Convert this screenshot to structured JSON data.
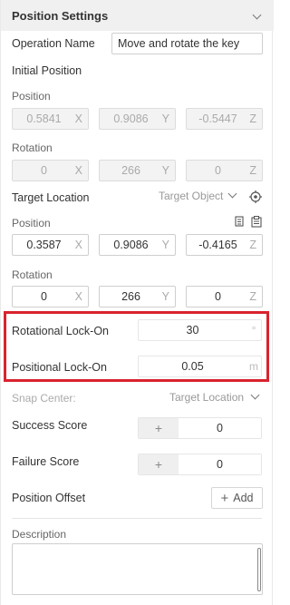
{
  "header": {
    "title": "Position Settings"
  },
  "operation": {
    "label": "Operation Name",
    "value": "Move and rotate the key"
  },
  "initial": {
    "heading": "Initial Position",
    "position_label": "Position",
    "position": {
      "x": "0.5841",
      "y": "0.9086",
      "z": "-0.5447"
    },
    "rotation_label": "Rotation",
    "rotation": {
      "x": "0",
      "y": "266",
      "z": "0"
    }
  },
  "axes": {
    "x": "X",
    "y": "Y",
    "z": "Z"
  },
  "target": {
    "label": "Target Location",
    "dropdown_value": "Target Object",
    "position_label": "Position",
    "position": {
      "x": "0.3587",
      "y": "0.9086",
      "z": "-0.4165"
    },
    "rotation_label": "Rotation",
    "rotation": {
      "x": "0",
      "y": "266",
      "z": "0"
    }
  },
  "lock": {
    "rotational_label": "Rotational Lock-On",
    "rotational_value": "30",
    "rotational_unit": "°",
    "positional_label": "Positional Lock-On",
    "positional_value": "0.05",
    "positional_unit": "m",
    "highlight_color": "#d9232e"
  },
  "snap": {
    "label": "Snap Center:",
    "value": "Target Location"
  },
  "success": {
    "label": "Success Score",
    "plus": "+",
    "value": "0"
  },
  "failure": {
    "label": "Failure Score",
    "plus": "+",
    "value": "0"
  },
  "offset": {
    "label": "Position Offset",
    "add_label": "Add",
    "add_icon": "+"
  },
  "description": {
    "label": "Description",
    "value": ""
  }
}
